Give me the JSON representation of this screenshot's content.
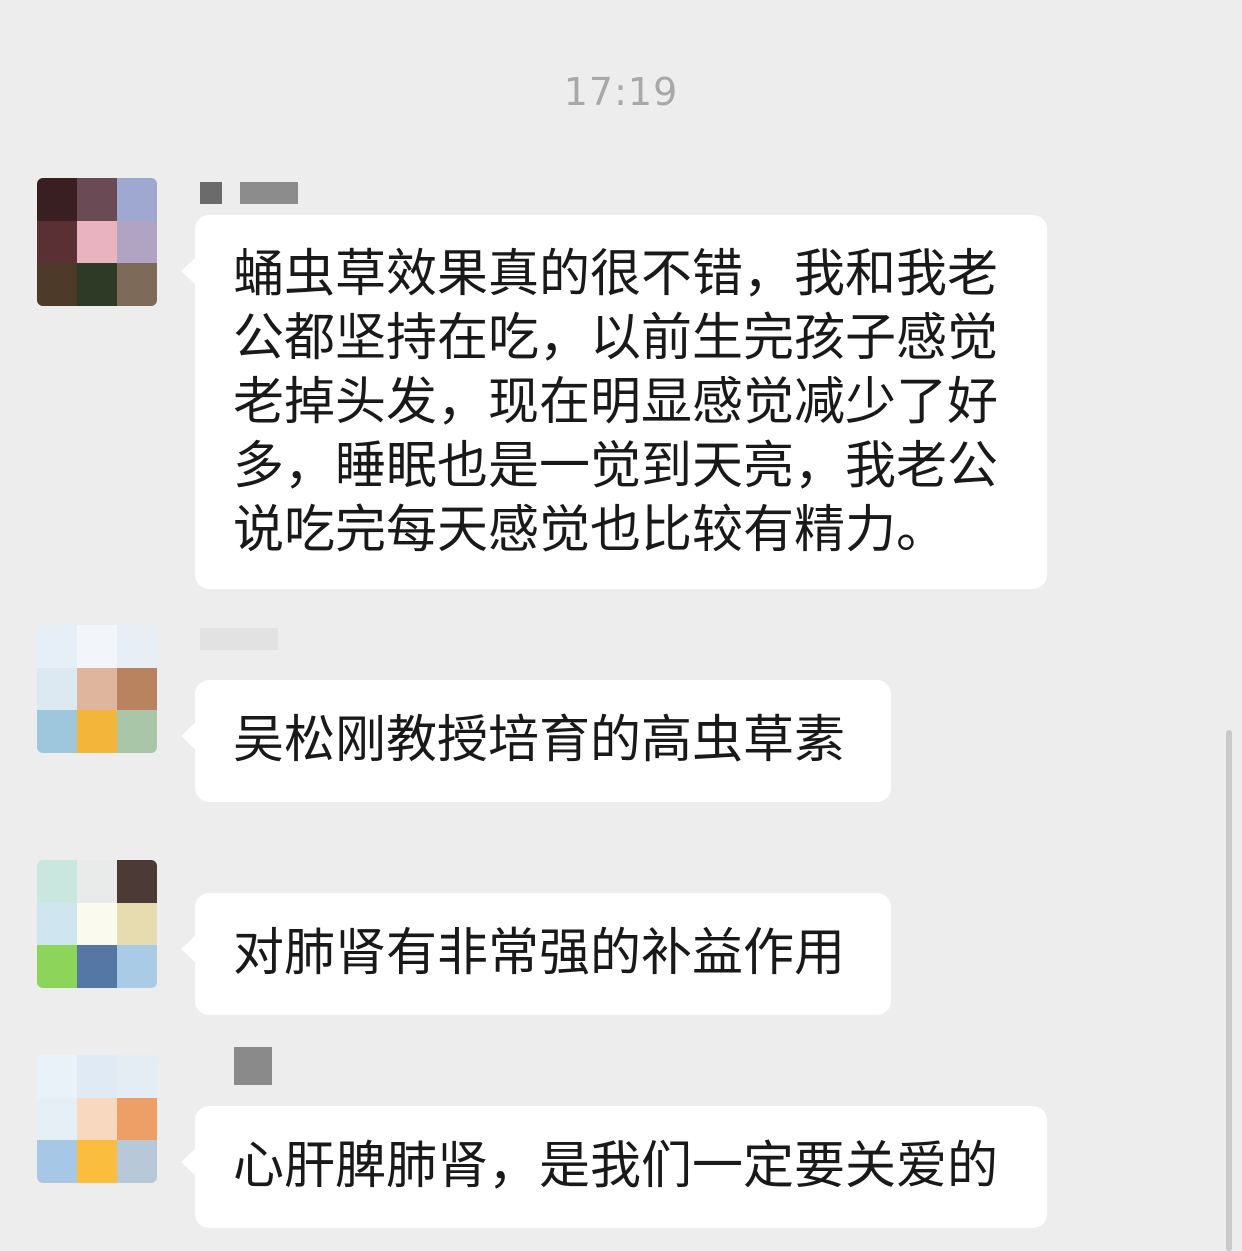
{
  "chat": {
    "timestamp": "17:19",
    "messages": [
      {
        "avatar": "blurred-avatar",
        "text": "蛹虫草效果真的很不错，我和我老\n公都坚持在吃，以前生完孩子感觉\n老掉头发，现在明显感觉减少了好\n多，睡眠也是一觉到天亮，我老公\n说吃完每天感觉也比较有精力。"
      },
      {
        "avatar": "blurred-avatar",
        "text": "吴松刚教授培育的高虫草素"
      },
      {
        "avatar": "blurred-avatar",
        "text": "对肺肾有非常强的补益作用"
      },
      {
        "avatar": "blurred-avatar",
        "text": "心肝脾肺肾，是我们一定要关爱的"
      }
    ]
  },
  "colors": {
    "background": "#ededed",
    "bubble": "#ffffff",
    "text": "#191919",
    "timestamp": "#a8a8a8"
  }
}
